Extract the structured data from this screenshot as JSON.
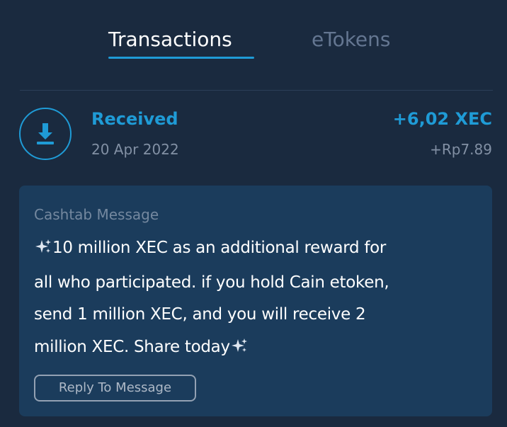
{
  "tabs": [
    {
      "label": "Transactions",
      "active": true
    },
    {
      "label": "eTokens",
      "active": false
    }
  ],
  "transaction": {
    "type": "Received",
    "date": "20 Apr 2022",
    "amount": "+6,02 XEC",
    "fiat_amount": "+Rp7.89",
    "icon": "download-icon"
  },
  "message": {
    "label": "Cashtab Message",
    "lines": [
      "10 million XEC as an additional reward for",
      "all who participated. if you hold Cain etoken,",
      "send 1 million XEC, and you will receive 2",
      "million XEC. Share today"
    ],
    "emoji": "sparkles-icon",
    "reply_label": "Reply To Message"
  },
  "colors": {
    "background": "#1a2a3f",
    "accent": "#1f9bd6",
    "message_bg": "#1b3c5c",
    "muted_text": "#8290a4"
  }
}
